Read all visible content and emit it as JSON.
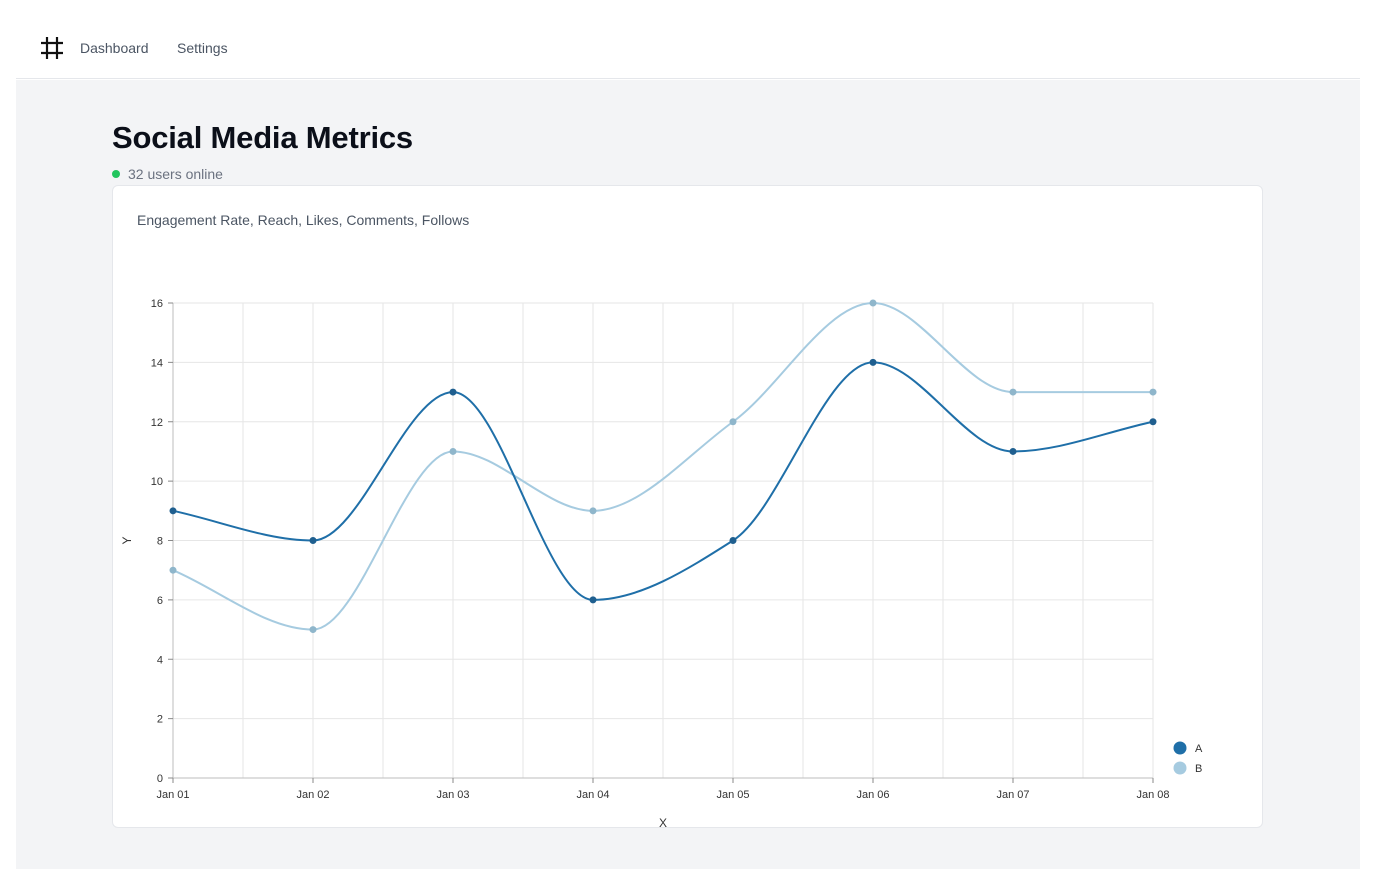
{
  "nav": {
    "logo_icon": "hash-grid-icon",
    "links": [
      {
        "label": "Dashboard"
      },
      {
        "label": "Settings"
      }
    ]
  },
  "page": {
    "title": "Social Media Metrics",
    "status_text": "32 users online",
    "status_color": "#22c55e"
  },
  "chart_data": {
    "type": "line",
    "title": "Engagement Rate, Reach, Likes, Comments, Follows",
    "xlabel": "X",
    "ylabel": "Y",
    "categories": [
      "Jan 01",
      "Jan 02",
      "Jan 03",
      "Jan 04",
      "Jan 05",
      "Jan 06",
      "Jan 07",
      "Jan 08"
    ],
    "ylim": [
      0,
      16
    ],
    "yticks": [
      0,
      2,
      4,
      6,
      8,
      10,
      12,
      14,
      16
    ],
    "grid": true,
    "legend_position": "bottom-right",
    "curve": "smooth",
    "series": [
      {
        "name": "A",
        "color": "#1f6fa8",
        "point_color": "#1f5f8f",
        "values": [
          9,
          8,
          13,
          6,
          8,
          14,
          11,
          12
        ]
      },
      {
        "name": "B",
        "color": "#a6cbe0",
        "point_color": "#8fb6cb",
        "values": [
          7,
          5,
          11,
          9,
          12,
          16,
          13,
          13
        ]
      }
    ]
  }
}
